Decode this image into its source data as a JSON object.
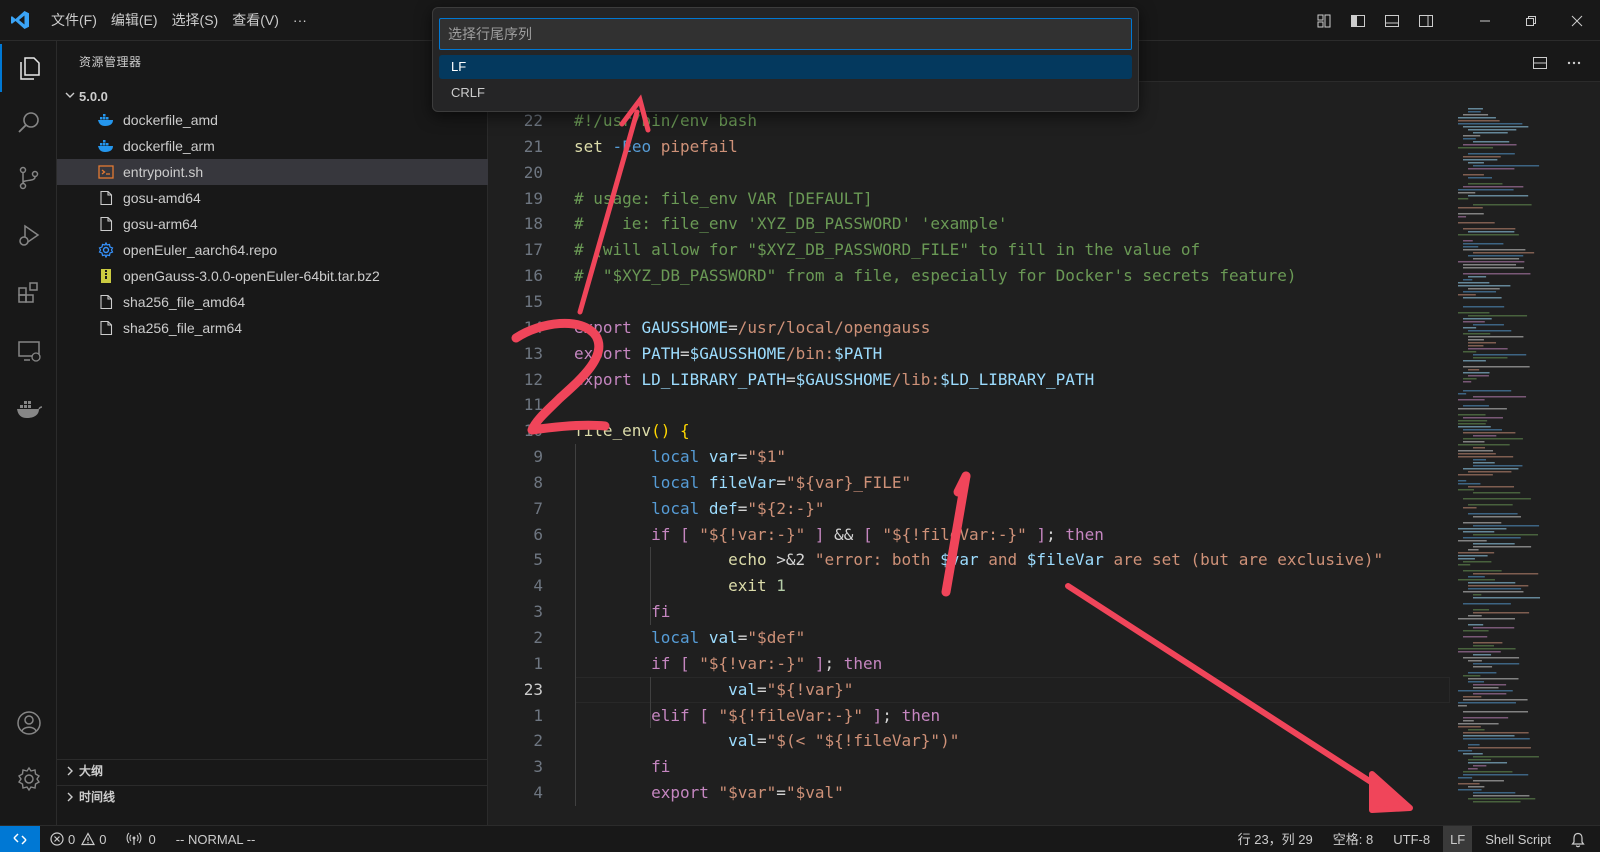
{
  "menu": {
    "items": [
      "文件(F)",
      "编辑(E)",
      "选择(S)",
      "查看(V)",
      "···"
    ]
  },
  "sidebar": {
    "title": "资源管理器",
    "folder": "5.0.0",
    "files": [
      {
        "name": "dockerfile_amd",
        "icon": "docker-icon"
      },
      {
        "name": "dockerfile_arm",
        "icon": "docker-icon"
      },
      {
        "name": "entrypoint.sh",
        "icon": "shell-icon",
        "selected": true
      },
      {
        "name": "gosu-amd64",
        "icon": "file-icon"
      },
      {
        "name": "gosu-arm64",
        "icon": "file-icon"
      },
      {
        "name": "openEuler_aarch64.repo",
        "icon": "gear-icon"
      },
      {
        "name": "openGauss-3.0.0-openEuler-64bit.tar.bz2",
        "icon": "archive-icon"
      },
      {
        "name": "sha256_file_amd64",
        "icon": "file-icon"
      },
      {
        "name": "sha256_file_arm64",
        "icon": "file-icon"
      }
    ],
    "outline": "大纲",
    "timeline": "时间线"
  },
  "quickpick": {
    "placeholder": "选择行尾序列",
    "options": [
      "LF",
      "CRLF"
    ],
    "active_index": 0
  },
  "editor": {
    "current_line_number": "23",
    "lines": [
      {
        "num": "22",
        "tokens": [
          [
            "t-comment",
            "#!/usr/bin/env bash"
          ]
        ]
      },
      {
        "num": "21",
        "tokens": [
          [
            "t-builtin",
            "set"
          ],
          [
            "t-plain",
            " "
          ],
          [
            "t-param",
            "-Eeo"
          ],
          [
            "t-plain",
            " "
          ],
          [
            "t-str",
            "pipefail"
          ]
        ]
      },
      {
        "num": "20",
        "tokens": []
      },
      {
        "num": "19",
        "tokens": [
          [
            "t-comment",
            "# usage: file_env VAR [DEFAULT]"
          ]
        ]
      },
      {
        "num": "18",
        "tokens": [
          [
            "t-comment",
            "#    ie: file_env 'XYZ_DB_PASSWORD' 'example'"
          ]
        ]
      },
      {
        "num": "17",
        "tokens": [
          [
            "t-comment",
            "# (will allow for \"$XYZ_DB_PASSWORD_FILE\" to fill in the value of"
          ]
        ]
      },
      {
        "num": "16",
        "tokens": [
          [
            "t-comment",
            "#  \"$XYZ_DB_PASSWORD\" from a file, especially for Docker's secrets feature)"
          ]
        ]
      },
      {
        "num": "15",
        "tokens": []
      },
      {
        "num": "14",
        "tokens": [
          [
            "t-kw",
            "export"
          ],
          [
            "t-plain",
            " "
          ],
          [
            "t-var",
            "GAUSSHOME"
          ],
          [
            "t-plain",
            "="
          ],
          [
            "t-str",
            "/usr/local/opengauss"
          ]
        ]
      },
      {
        "num": "13",
        "tokens": [
          [
            "t-kw",
            "export"
          ],
          [
            "t-plain",
            " "
          ],
          [
            "t-var",
            "PATH"
          ],
          [
            "t-plain",
            "="
          ],
          [
            "t-var",
            "$GAUSSHOME"
          ],
          [
            "t-str",
            "/bin:"
          ],
          [
            "t-var",
            "$PATH"
          ]
        ]
      },
      {
        "num": "12",
        "tokens": [
          [
            "t-kw",
            "export"
          ],
          [
            "t-plain",
            " "
          ],
          [
            "t-var",
            "LD_LIBRARY_PATH"
          ],
          [
            "t-plain",
            "="
          ],
          [
            "t-var",
            "$GAUSSHOME"
          ],
          [
            "t-str",
            "/lib:"
          ],
          [
            "t-var",
            "$LD_LIBRARY_PATH"
          ]
        ]
      },
      {
        "num": "11",
        "tokens": []
      },
      {
        "num": "10",
        "tokens": [
          [
            "t-func",
            "file_env"
          ],
          [
            "t-brace",
            "()"
          ],
          [
            "t-plain",
            " "
          ],
          [
            "t-brace",
            "{"
          ]
        ]
      },
      {
        "num": "9",
        "tokens": [
          [
            "t-plain",
            "        "
          ],
          [
            "t-param",
            "local"
          ],
          [
            "t-plain",
            " "
          ],
          [
            "t-var",
            "var"
          ],
          [
            "t-plain",
            "="
          ],
          [
            "t-str",
            "\"$1\""
          ]
        ]
      },
      {
        "num": "8",
        "tokens": [
          [
            "t-plain",
            "        "
          ],
          [
            "t-param",
            "local"
          ],
          [
            "t-plain",
            " "
          ],
          [
            "t-var",
            "fileVar"
          ],
          [
            "t-plain",
            "="
          ],
          [
            "t-str",
            "\"${var}_FILE\""
          ]
        ]
      },
      {
        "num": "7",
        "tokens": [
          [
            "t-plain",
            "        "
          ],
          [
            "t-param",
            "local"
          ],
          [
            "t-plain",
            " "
          ],
          [
            "t-var",
            "def"
          ],
          [
            "t-plain",
            "="
          ],
          [
            "t-str",
            "\"${2:-}\""
          ]
        ]
      },
      {
        "num": "6",
        "tokens": [
          [
            "t-plain",
            "        "
          ],
          [
            "t-kw",
            "if"
          ],
          [
            "t-plain",
            " "
          ],
          [
            "t-kw",
            "["
          ],
          [
            "t-plain",
            " "
          ],
          [
            "t-str",
            "\"${!var:-}\""
          ],
          [
            "t-plain",
            " "
          ],
          [
            "t-kw",
            "]"
          ],
          [
            "t-plain",
            " && "
          ],
          [
            "t-kw",
            "["
          ],
          [
            "t-plain",
            " "
          ],
          [
            "t-str",
            "\"${!fileVar:-}\""
          ],
          [
            "t-plain",
            " "
          ],
          [
            "t-kw",
            "]"
          ],
          [
            "t-plain",
            "; "
          ],
          [
            "t-kw",
            "then"
          ]
        ]
      },
      {
        "num": "5",
        "tokens": [
          [
            "t-plain",
            "                "
          ],
          [
            "t-builtin",
            "echo"
          ],
          [
            "t-plain",
            " >&2 "
          ],
          [
            "t-str",
            "\"error: both "
          ],
          [
            "t-var",
            "$var"
          ],
          [
            "t-str",
            " and "
          ],
          [
            "t-var",
            "$fileVar"
          ],
          [
            "t-str",
            " are set (but are exclusive)\""
          ]
        ]
      },
      {
        "num": "4",
        "tokens": [
          [
            "t-plain",
            "                "
          ],
          [
            "t-builtin",
            "exit"
          ],
          [
            "t-plain",
            " "
          ],
          [
            "t-num",
            "1"
          ]
        ]
      },
      {
        "num": "3",
        "tokens": [
          [
            "t-plain",
            "        "
          ],
          [
            "t-kw",
            "fi"
          ]
        ]
      },
      {
        "num": "2",
        "tokens": [
          [
            "t-plain",
            "        "
          ],
          [
            "t-param",
            "local"
          ],
          [
            "t-plain",
            " "
          ],
          [
            "t-var",
            "val"
          ],
          [
            "t-plain",
            "="
          ],
          [
            "t-str",
            "\"$def\""
          ]
        ]
      },
      {
        "num": "1",
        "tokens": [
          [
            "t-plain",
            "        "
          ],
          [
            "t-kw",
            "if"
          ],
          [
            "t-plain",
            " "
          ],
          [
            "t-kw",
            "["
          ],
          [
            "t-plain",
            " "
          ],
          [
            "t-str",
            "\"${!var:-}\""
          ],
          [
            "t-plain",
            " "
          ],
          [
            "t-kw",
            "]"
          ],
          [
            "t-plain",
            "; "
          ],
          [
            "t-kw",
            "then"
          ]
        ]
      },
      {
        "num": "23",
        "current": true,
        "tokens": [
          [
            "t-plain",
            "                "
          ],
          [
            "t-var",
            "val"
          ],
          [
            "t-plain",
            "="
          ],
          [
            "t-str",
            "\"${!var}\""
          ]
        ]
      },
      {
        "num": "1",
        "tokens": [
          [
            "t-plain",
            "        "
          ],
          [
            "t-kw",
            "elif"
          ],
          [
            "t-plain",
            " "
          ],
          [
            "t-kw",
            "["
          ],
          [
            "t-plain",
            " "
          ],
          [
            "t-str",
            "\"${!fileVar:-}\""
          ],
          [
            "t-plain",
            " "
          ],
          [
            "t-kw",
            "]"
          ],
          [
            "t-plain",
            "; "
          ],
          [
            "t-kw",
            "then"
          ]
        ]
      },
      {
        "num": "2",
        "tokens": [
          [
            "t-plain",
            "                "
          ],
          [
            "t-var",
            "val"
          ],
          [
            "t-plain",
            "="
          ],
          [
            "t-str",
            "\"$(< \"${!fileVar}\")\""
          ]
        ]
      },
      {
        "num": "3",
        "tokens": [
          [
            "t-plain",
            "        "
          ],
          [
            "t-kw",
            "fi"
          ]
        ]
      },
      {
        "num": "4",
        "tokens": [
          [
            "t-plain",
            "        "
          ],
          [
            "t-kw",
            "export"
          ],
          [
            "t-plain",
            " "
          ],
          [
            "t-str",
            "\"$var\""
          ],
          [
            "t-plain",
            "="
          ],
          [
            "t-str",
            "\"$val\""
          ]
        ]
      }
    ]
  },
  "statusbar": {
    "errors": "0",
    "warnings": "0",
    "ports": "0",
    "vim_mode": "-- NORMAL --",
    "position": "行 23，列 29",
    "spaces": "空格: 8",
    "encoding": "UTF-8",
    "eol": "LF",
    "language": "Shell Script"
  },
  "colors": {
    "accent": "#0078d4",
    "annotation": "#f0455a"
  }
}
